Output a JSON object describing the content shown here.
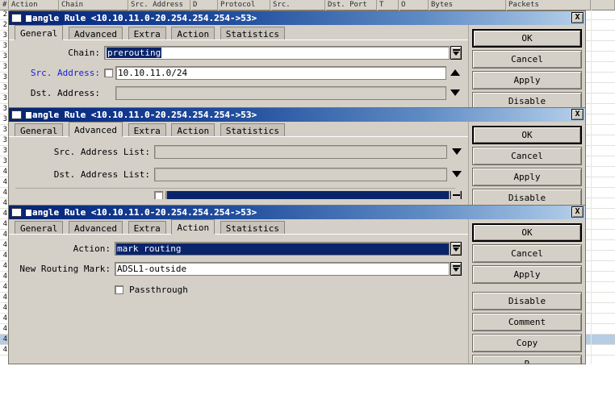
{
  "background_list": {
    "columns": [
      "#",
      "Action",
      "Chain",
      "Src. Address",
      "D",
      "Protocol",
      "Src.",
      "Dst. Port",
      "T",
      "O",
      "Bytes",
      "Packets"
    ],
    "rows": [
      {
        "num": "2"
      },
      {
        "num": "2"
      },
      {
        "num": "3"
      },
      {
        "num": "3"
      },
      {
        "num": "3"
      },
      {
        "num": "3"
      },
      {
        "num": "3"
      },
      {
        "num": "3"
      },
      {
        "num": "3"
      },
      {
        "num": "3"
      },
      {
        "num": "3"
      },
      {
        "num": "3"
      },
      {
        "num": "3"
      },
      {
        "num": "3"
      },
      {
        "num": "3"
      },
      {
        "num": "4"
      },
      {
        "num": "4"
      },
      {
        "num": "4"
      },
      {
        "num": "4"
      },
      {
        "num": "4"
      },
      {
        "num": "4"
      },
      {
        "num": "4"
      },
      {
        "num": "4"
      },
      {
        "num": "4"
      },
      {
        "num": "4"
      },
      {
        "num": "4"
      },
      {
        "num": "4"
      },
      {
        "num": "4"
      },
      {
        "num": "4"
      },
      {
        "num": "4"
      },
      {
        "num": "4"
      },
      {
        "num": "4"
      },
      {
        "num": "4"
      }
    ]
  },
  "dialog_general": {
    "title": "angle Rule <10.10.11.0-20.254.254.254->53>",
    "close_label": "X",
    "tabs": [
      {
        "label": "General",
        "active": true
      },
      {
        "label": "Advanced",
        "active": false
      },
      {
        "label": "Extra",
        "active": false
      },
      {
        "label": "Action",
        "active": false
      },
      {
        "label": "Statistics",
        "active": false
      }
    ],
    "fields": {
      "chain_label": "Chain:",
      "chain_value": "prerouting",
      "src_address_label": "Src. Address:",
      "src_address_value": "10.10.11.0/24",
      "dst_address_label": "Dst. Address:",
      "dst_address_value": ""
    },
    "buttons": [
      "OK",
      "Cancel",
      "Apply",
      "Disable"
    ]
  },
  "dialog_advanced": {
    "title": "angle Rule <10.10.11.0-20.254.254.254->53>",
    "close_label": "X",
    "tabs": [
      {
        "label": "General",
        "active": false
      },
      {
        "label": "Advanced",
        "active": true
      },
      {
        "label": "Extra",
        "active": false
      },
      {
        "label": "Action",
        "active": false
      },
      {
        "label": "Statistics",
        "active": false
      }
    ],
    "fields": {
      "src_address_list_label": "Src. Address List:",
      "src_address_list_value": "",
      "dst_address_list_label": "Dst. Address List:",
      "dst_address_list_value": ""
    },
    "buttons": [
      "OK",
      "Cancel",
      "Apply",
      "Disable"
    ]
  },
  "dialog_action": {
    "title": "angle Rule <10.10.11.0-20.254.254.254->53>",
    "close_label": "X",
    "tabs": [
      {
        "label": "General",
        "active": false
      },
      {
        "label": "Advanced",
        "active": false
      },
      {
        "label": "Extra",
        "active": false
      },
      {
        "label": "Action",
        "active": true
      },
      {
        "label": "Statistics",
        "active": false
      }
    ],
    "fields": {
      "action_label": "Action:",
      "action_value": "mark routing",
      "new_routing_mark_label": "New Routing Mark:",
      "new_routing_mark_value": "ADSL1-outside",
      "passthrough_label": "Passthrough",
      "passthrough_checked": false
    },
    "buttons": [
      "OK",
      "Cancel",
      "Apply",
      "Disable",
      "Comment",
      "Copy",
      "R"
    ]
  },
  "colors": {
    "title_start": "#08246b",
    "title_end": "#b9d0e8",
    "face": "#d4d0c8",
    "selection": "#0a246a",
    "blue_label": "#1b1bdd"
  }
}
